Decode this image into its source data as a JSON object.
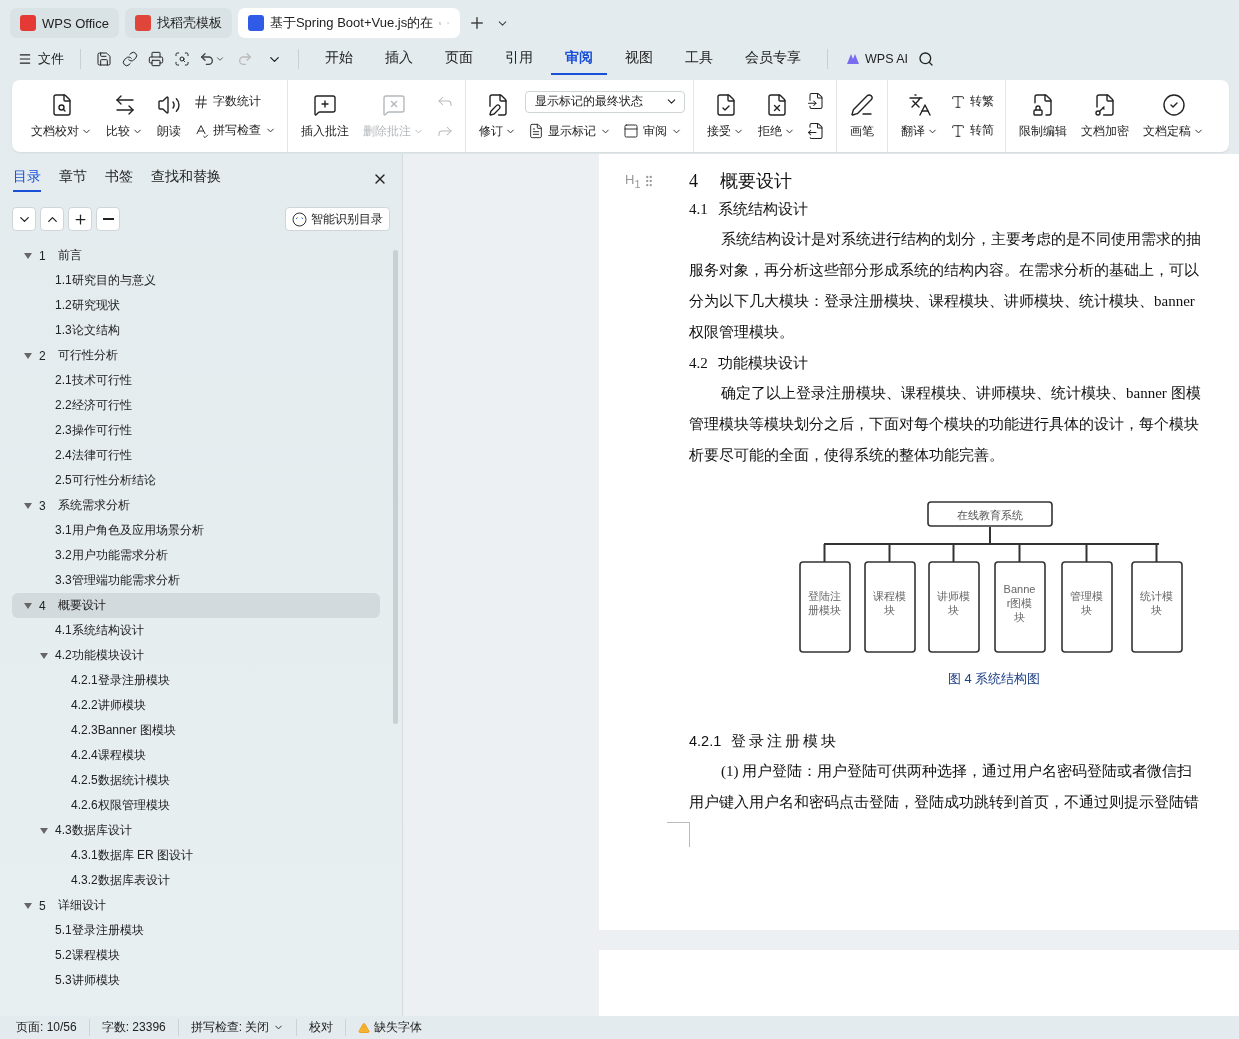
{
  "browser_tabs": [
    {
      "label": "WPS Office",
      "selected": false,
      "kind": "wps"
    },
    {
      "label": "找稻壳模板",
      "selected": false,
      "kind": "docer"
    },
    {
      "label": "基于Spring Boot+Vue.js的在",
      "selected": true,
      "kind": "writer"
    }
  ],
  "file_menu": "文件",
  "menu_tabs": [
    {
      "label": "开始",
      "selected": false
    },
    {
      "label": "插入",
      "selected": false
    },
    {
      "label": "页面",
      "selected": false
    },
    {
      "label": "引用",
      "selected": false
    },
    {
      "label": "审阅",
      "selected": true
    },
    {
      "label": "视图",
      "selected": false
    },
    {
      "label": "工具",
      "selected": false
    },
    {
      "label": "会员专享",
      "selected": false
    }
  ],
  "ai_label": "WPS AI",
  "ribbon": {
    "groups": [
      {
        "columns": [
          {
            "kind": "large",
            "label": "文档校对",
            "caret": true,
            "disabled": false
          },
          {
            "kind": "large",
            "label": "比较",
            "caret": true,
            "disabled": false
          },
          {
            "kind": "large",
            "label": "朗读",
            "caret": false,
            "disabled": false
          },
          {
            "kind": "stack",
            "items": [
              {
                "kind": "small",
                "label": "字数统计",
                "caret": false,
                "disabled": false
              },
              {
                "kind": "small",
                "label": "拼写检查",
                "caret": true,
                "disabled": false
              }
            ]
          }
        ]
      },
      {
        "columns": [
          {
            "kind": "large",
            "label": "插入批注",
            "caret": false,
            "disabled": false
          },
          {
            "kind": "large",
            "label": "删除批注",
            "caret": true,
            "disabled": true
          },
          {
            "kind": "stack",
            "items": [
              {
                "kind": "icon",
                "disabled": true
              },
              {
                "kind": "icon",
                "disabled": true
              }
            ]
          }
        ]
      },
      {
        "columns": [
          {
            "kind": "large",
            "label": "修订",
            "caret": true,
            "disabled": false
          },
          {
            "kind": "stack",
            "items": [
              {
                "kind": "select",
                "value": "显示标记的最终状态"
              },
              {
                "kind": "row",
                "items": [
                  {
                    "kind": "small",
                    "label": "显示标记",
                    "caret": true,
                    "disabled": false
                  },
                  {
                    "kind": "small",
                    "label": "审阅",
                    "caret": true,
                    "disabled": false
                  }
                ]
              }
            ]
          }
        ]
      },
      {
        "columns": [
          {
            "kind": "large",
            "label": "接受",
            "caret": true,
            "disabled": false
          },
          {
            "kind": "large",
            "label": "拒绝",
            "caret": true,
            "disabled": false
          },
          {
            "kind": "stack",
            "items": [
              {
                "kind": "icon",
                "disabled": false
              },
              {
                "kind": "icon",
                "disabled": false
              }
            ]
          }
        ]
      },
      {
        "columns": [
          {
            "kind": "large",
            "label": "画笔",
            "caret": false,
            "disabled": false
          }
        ]
      },
      {
        "columns": [
          {
            "kind": "large",
            "label": "翻译",
            "caret": true,
            "disabled": false
          },
          {
            "kind": "stack",
            "items": [
              {
                "kind": "small",
                "label": "转繁",
                "caret": false,
                "disabled": false
              },
              {
                "kind": "small",
                "label": "转简",
                "caret": false,
                "disabled": false
              }
            ]
          }
        ]
      },
      {
        "columns": [
          {
            "kind": "large",
            "label": "限制编辑",
            "caret": false,
            "disabled": false
          },
          {
            "kind": "large",
            "label": "文档加密",
            "caret": false,
            "disabled": false
          },
          {
            "kind": "large",
            "label": "文档定稿",
            "caret": true,
            "disabled": false
          }
        ]
      }
    ]
  },
  "outline_pane": {
    "tabs": [
      {
        "label": "目录",
        "selected": true
      },
      {
        "label": "章节",
        "selected": false
      },
      {
        "label": "书签",
        "selected": false
      },
      {
        "label": "查找和替换",
        "selected": false
      }
    ],
    "smart_button": "智能识别目录",
    "items": [
      {
        "number": "1",
        "title": "前言",
        "expanded": true,
        "selected": false,
        "children": [
          {
            "title": "1.1研究目的与意义",
            "selected": false
          },
          {
            "title": "1.2研究现状",
            "selected": false
          },
          {
            "title": "1.3论文结构",
            "selected": false
          }
        ]
      },
      {
        "number": "2",
        "title": "可行性分析",
        "expanded": true,
        "selected": false,
        "children": [
          {
            "title": "2.1技术可行性",
            "selected": false
          },
          {
            "title": "2.2经济可行性",
            "selected": false
          },
          {
            "title": "2.3操作可行性",
            "selected": false
          },
          {
            "title": "2.4法律可行性",
            "selected": false
          },
          {
            "title": "2.5可行性分析结论",
            "selected": false
          }
        ]
      },
      {
        "number": "3",
        "title": "系统需求分析",
        "expanded": true,
        "selected": false,
        "children": [
          {
            "title": "3.1用户角色及应用场景分析",
            "selected": false
          },
          {
            "title": "3.2用户功能需求分析",
            "selected": false
          },
          {
            "title": "3.3管理端功能需求分析",
            "selected": false
          }
        ]
      },
      {
        "number": "4",
        "title": "概要设计",
        "expanded": true,
        "selected": true,
        "children": [
          {
            "title": "4.1系统结构设计",
            "selected": false
          },
          {
            "title": "4.2功能模块设计",
            "expanded": true,
            "selected": false,
            "children": [
              {
                "title": "4.2.1登录注册模块",
                "selected": false
              },
              {
                "title": "4.2.2讲师模块",
                "selected": false
              },
              {
                "title": "4.2.3Banner 图模块",
                "selected": false
              },
              {
                "title": "4.2.4课程模块",
                "selected": false
              },
              {
                "title": "4.2.5数据统计模块",
                "selected": false
              },
              {
                "title": "4.2.6权限管理模块",
                "selected": false
              }
            ]
          },
          {
            "title": "4.3数据库设计",
            "expanded": true,
            "selected": false,
            "children": [
              {
                "title": "4.3.1数据库 ER 图设计",
                "selected": false
              },
              {
                "title": "4.3.2数据库表设计",
                "selected": false
              }
            ]
          }
        ]
      },
      {
        "number": "5",
        "title": "详细设计",
        "expanded": true,
        "selected": false,
        "children": [
          {
            "title": "5.1登录注册模块",
            "selected": false
          },
          {
            "title": "5.2课程模块",
            "selected": false
          },
          {
            "title": "5.3讲师模块",
            "selected": false
          }
        ]
      }
    ]
  },
  "document": {
    "heading_marker": "H$_{1}$",
    "blocks": [
      {
        "kind": "heading1",
        "number": "4",
        "text": "概要设计"
      },
      {
        "kind": "heading2",
        "number": "4.1",
        "text": "系统结构设计"
      },
      {
        "kind": "paragraph",
        "lines": [
          "系统结构设计是对系统进行结构的划分，主要考虑的是不同使用需求的抽",
          "服务对象，再分析这些部分形成系统的结构内容。在需求分析的基础上，可以",
          "分为以下几大模块：登录注册模块、课程模块、讲师模块、统计模块、banner",
          "权限管理模块。"
        ]
      },
      {
        "kind": "heading2",
        "number": "4.2",
        "text": "功能模块设计"
      },
      {
        "kind": "paragraph",
        "lines": [
          "确定了以上登录注册模块、课程模块、讲师模块、统计模块、banner 图模",
          "管理模块等模块划分之后，下面对每个模块的功能进行具体的设计，每个模块",
          "析要尽可能的全面，使得系统的整体功能完善。"
        ]
      },
      {
        "kind": "figure",
        "root": "在线教育系统",
        "nodes": [
          [
            "登陆注",
            "册模块"
          ],
          [
            "课程模",
            "块"
          ],
          [
            "讲师模",
            "块"
          ],
          [
            "Banne",
            "r图模",
            "块"
          ],
          [
            "管理模",
            "块"
          ],
          [
            "统计模",
            "块"
          ]
        ],
        "caption": "图 4  系统结构图"
      },
      {
        "kind": "heading3",
        "number": "4.2.1",
        "text": "登录注册模块"
      },
      {
        "kind": "paragraph",
        "lines": [
          "(1) 用户登陆：用户登陆可供两种选择，通过用户名密码登陆或者微信扫",
          "用户键入用户名和密码点击登陆，登陆成功跳转到首页，不通过则提示登陆错"
        ]
      }
    ]
  },
  "status_bar": {
    "items": [
      {
        "kind": "plain",
        "label": "页面: 10/56",
        "caret": false
      },
      {
        "kind": "plain",
        "label": "字数: 23396",
        "caret": false
      },
      {
        "kind": "plain",
        "label": "拼写检查: 关闭",
        "caret": true
      },
      {
        "kind": "plain",
        "label": "校对",
        "caret": false
      },
      {
        "kind": "warning",
        "label": "缺失字体",
        "caret": false
      }
    ]
  }
}
